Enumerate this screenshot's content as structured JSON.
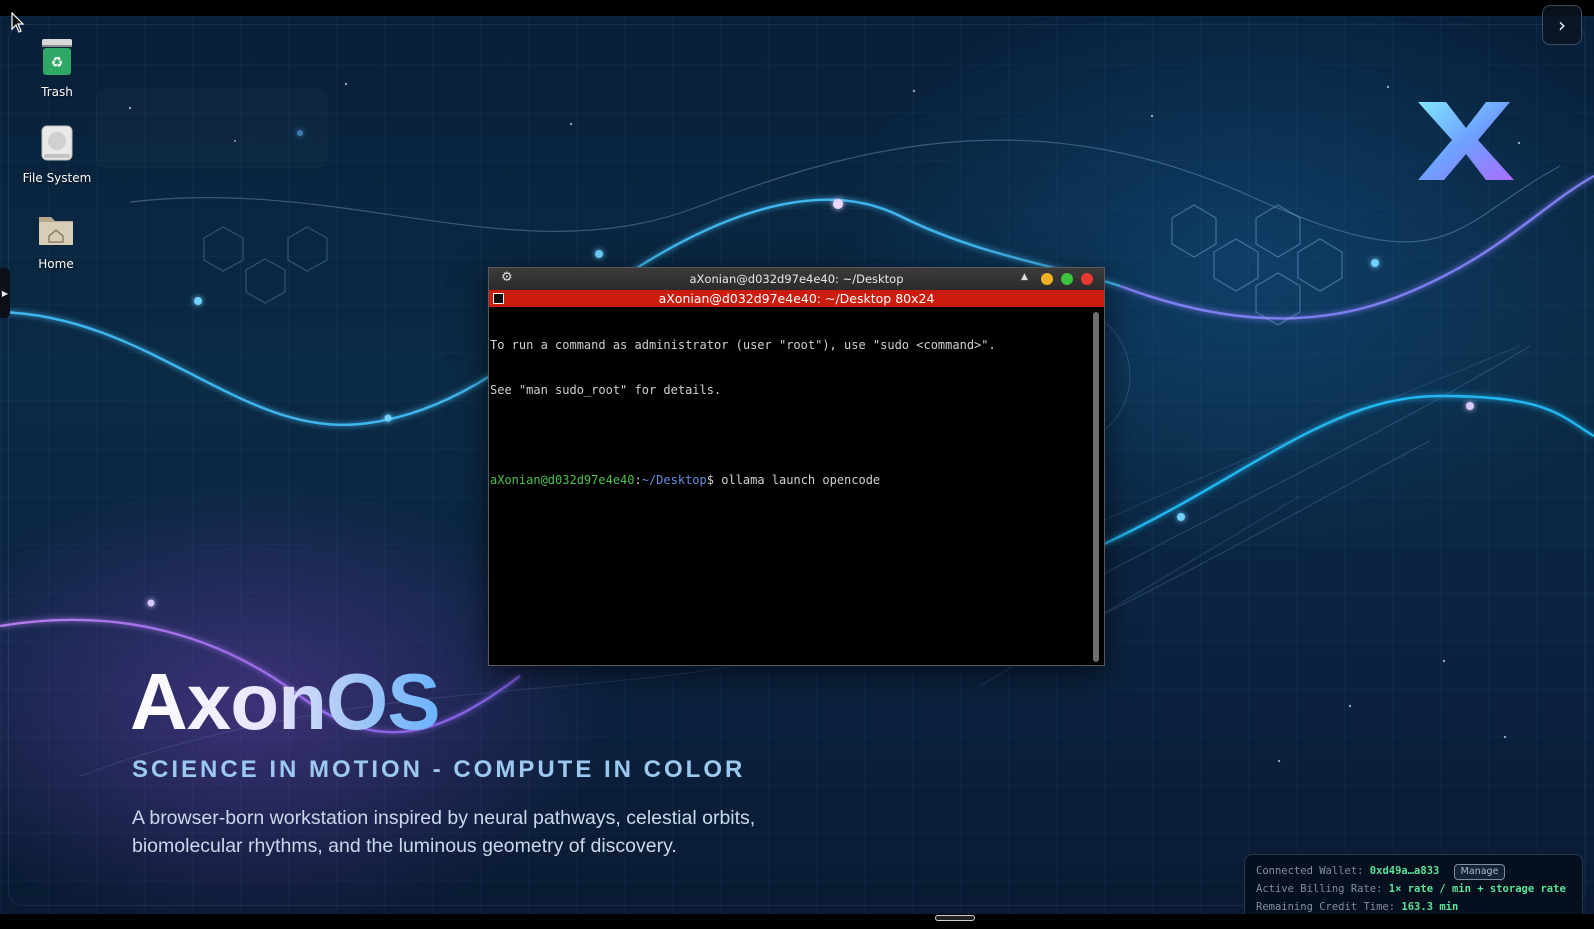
{
  "desktop": {
    "icons": [
      {
        "label": "Trash",
        "icon": "trash-icon"
      },
      {
        "label": "File System",
        "icon": "drive-icon"
      },
      {
        "label": "Home",
        "icon": "home-folder-icon"
      }
    ]
  },
  "brand": {
    "title": "AxonOS",
    "tagline": "SCIENCE IN MOTION - COMPUTE IN COLOR",
    "description": "A browser-born workstation inspired by neural pathways, celestial orbits, biomolecular rhythms, and the luminous geometry of discovery.",
    "logo_icon": "axon-x-logo"
  },
  "terminal": {
    "window_title": "aXonian@d032d97e4e40: ~/Desktop",
    "tab_title": "aXonian@d032d97e4e40: ~/Desktop 80x24",
    "lines": [
      "To run a command as administrator (user \"root\"), use \"sudo <command>\".",
      "See \"man sudo_root\" for details."
    ],
    "prompt_user": "aXonian@d032d97e4e40",
    "prompt_sep": ":",
    "prompt_path": "~/Desktop",
    "prompt_symbol": "$ ",
    "command": "ollama launch opencode"
  },
  "wallet": {
    "connected_label": "Connected Wallet:",
    "connected_value": "0xd49a…a833",
    "manage_label": "Manage",
    "billing_label": "Active Billing Rate:",
    "billing_value": "1× rate / min + storage rate",
    "credit_label": "Remaining Credit Time:",
    "credit_value": "163.3 min"
  },
  "colors": {
    "terminal_tab": "#cc1c10",
    "prompt_user": "#4ec24e",
    "prompt_path": "#6a8de0",
    "wallet_value": "#5be39a"
  }
}
